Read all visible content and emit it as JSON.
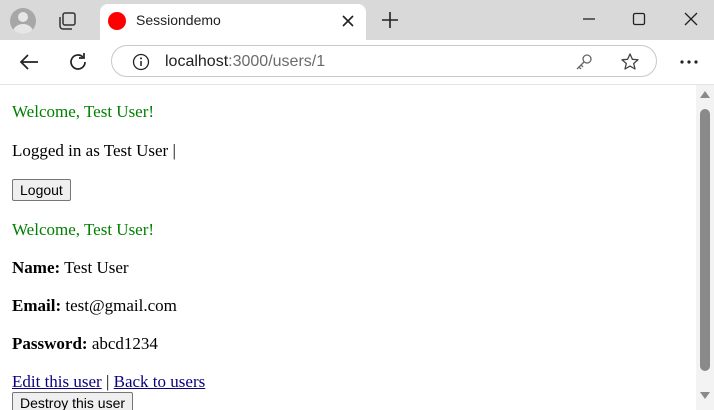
{
  "browser": {
    "tab": {
      "title": "Sessiondemo",
      "favicon_color": "#ff0000"
    },
    "address_bar": {
      "host": "localhost",
      "path": ":3000/users/1"
    },
    "icons": {
      "profile": "avatar-icon",
      "workspaces": "tabs-icon",
      "tab_close": "close-icon",
      "new_tab": "plus-icon",
      "minimize": "minimize-icon",
      "maximize": "maximize-icon",
      "close": "close-icon",
      "back": "back-arrow-icon",
      "reload": "reload-icon",
      "site_info": "info-icon",
      "password": "key-icon",
      "favorite": "star-icon",
      "menu": "more-icon"
    }
  },
  "page": {
    "notice_1": "Welcome, Test User!",
    "logged_in_text": "Logged in as Test User |",
    "logout_button": "Logout",
    "notice_2": "Welcome, Test User!",
    "fields": {
      "name_label": "Name:",
      "name_value": "Test User",
      "email_label": "Email:",
      "email_value": "test@gmail.com",
      "password_label": "Password:",
      "password_value": "abcd1234"
    },
    "links": {
      "edit": "Edit this user",
      "separator": "|",
      "back": "Back to users"
    },
    "destroy_button": "Destroy this user",
    "notice_color": "#008000",
    "link_color": "#0b0080"
  }
}
